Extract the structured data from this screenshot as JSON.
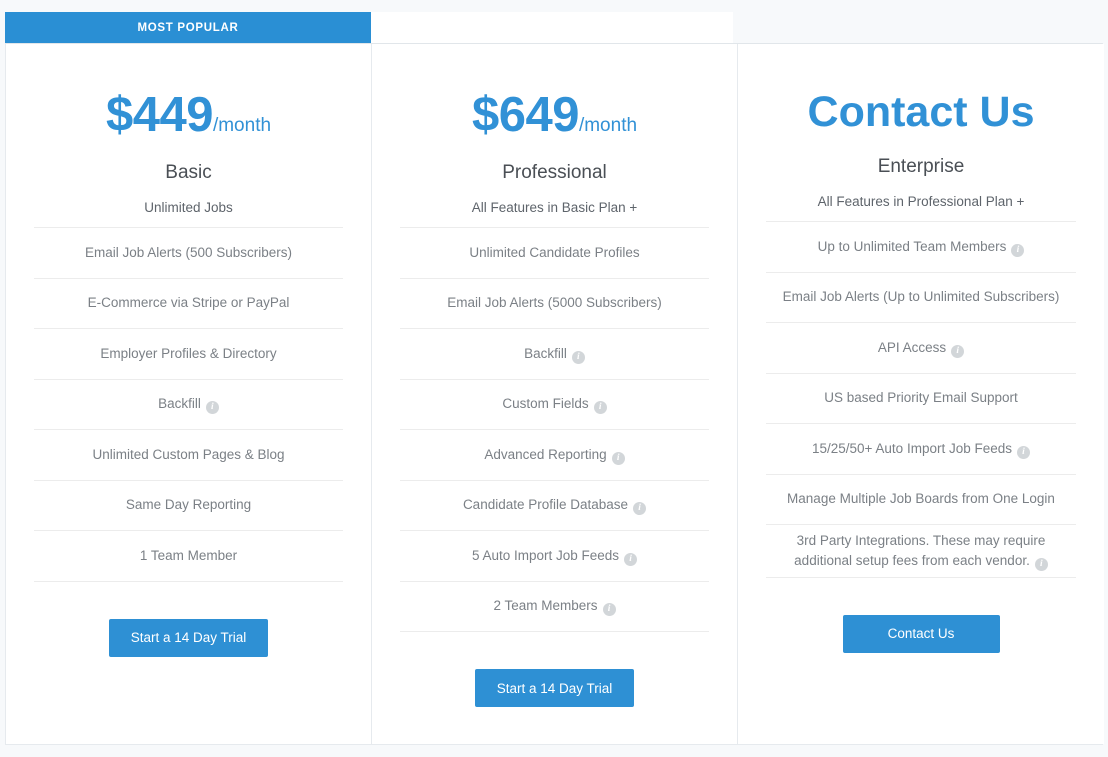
{
  "banner": {
    "label": "MOST POPULAR"
  },
  "colors": {
    "accent": "#2a8fd4",
    "price": "#3191d6",
    "button": "#2e90d4",
    "info_icon": "#d2d6d9",
    "divider": "#ececec",
    "page_background": "#f7f9fb"
  },
  "plans": [
    {
      "price_amount": "$449",
      "price_period": "/month",
      "name": "Basic",
      "subtitle": "Unlimited Jobs",
      "cta_label": "Start a 14 Day Trial",
      "features": [
        {
          "text": "Email Job Alerts (500 Subscribers)",
          "info": false
        },
        {
          "text": "E-Commerce via Stripe or PayPal",
          "info": false
        },
        {
          "text": "Employer Profiles & Directory",
          "info": false
        },
        {
          "text": "Backfill",
          "info": true
        },
        {
          "text": "Unlimited Custom Pages & Blog",
          "info": false
        },
        {
          "text": "Same Day Reporting",
          "info": false
        },
        {
          "text": "1 Team Member",
          "info": false
        }
      ]
    },
    {
      "price_amount": "$649",
      "price_period": "/month",
      "name": "Professional",
      "subtitle": "All Features in Basic Plan +",
      "cta_label": "Start a 14 Day Trial",
      "features": [
        {
          "text": "Unlimited Candidate Profiles",
          "info": false
        },
        {
          "text": "Email Job Alerts (5000 Subscribers)",
          "info": false
        },
        {
          "text": "Backfill",
          "info": true
        },
        {
          "text": "Custom Fields",
          "info": true
        },
        {
          "text": "Advanced Reporting",
          "info": true
        },
        {
          "text": "Candidate Profile Database",
          "info": true
        },
        {
          "text": "5 Auto Import Job Feeds",
          "info": true
        },
        {
          "text": "2 Team Members",
          "info": true
        }
      ]
    },
    {
      "price_amount": "Contact Us",
      "price_period": "",
      "name": "Enterprise",
      "subtitle": "All Features in Professional Plan +",
      "cta_label": "Contact Us",
      "features": [
        {
          "text": "Up to Unlimited Team Members",
          "info": true
        },
        {
          "text": "Email Job Alerts (Up to Unlimited Subscribers)",
          "info": false
        },
        {
          "text": "API Access",
          "info": true
        },
        {
          "text": "US based Priority Email Support",
          "info": false
        },
        {
          "text": "15/25/50+ Auto Import Job Feeds",
          "info": true
        },
        {
          "text": "Manage Multiple Job Boards from One Login",
          "info": false
        },
        {
          "text": "3rd Party Integrations. These may require additional setup fees from each vendor.",
          "info": true
        }
      ]
    }
  ],
  "info_icon_glyph": "i"
}
